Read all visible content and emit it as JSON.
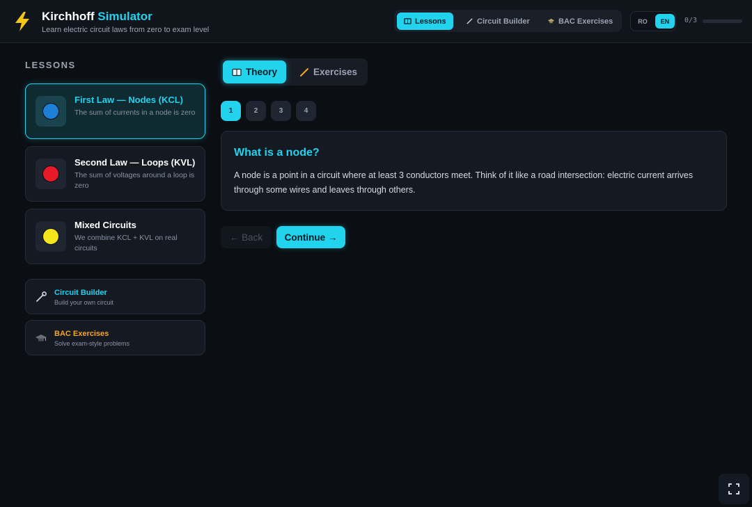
{
  "header": {
    "title_main": "Kirchhoff",
    "title_accent": "Simulator",
    "subtitle": "Learn electric circuit laws from zero to exam level",
    "nav": [
      {
        "label": "Lessons",
        "icon": "book-icon",
        "active": true
      },
      {
        "label": "Circuit Builder",
        "icon": "pencil-icon",
        "active": false
      },
      {
        "label": "BAC Exercises",
        "icon": "graduation-cap-icon",
        "active": false
      }
    ],
    "languages": [
      {
        "label": "RO",
        "active": false
      },
      {
        "label": "EN",
        "active": true
      }
    ],
    "progress_text": "0/3",
    "progress_value": 0
  },
  "sidebar": {
    "heading": "LESSONS",
    "lessons": [
      {
        "title": "First Law — Nodes (KCL)",
        "description": "The sum of currents in a node is zero",
        "dot_color": "#1e7fd6",
        "active": true
      },
      {
        "title": "Second Law — Loops (KVL)",
        "description": "The sum of voltages around a loop is zero",
        "dot_color": "#e81a2a",
        "active": false
      },
      {
        "title": "Mixed Circuits",
        "description": "We combine KCL + KVL on real circuits",
        "dot_color": "#f5e51a",
        "active": false
      }
    ],
    "tools": [
      {
        "title": "Circuit Builder",
        "description": "Build your own circuit",
        "title_color": "#22d3ee",
        "icon": "wrench-icon"
      },
      {
        "title": "BAC Exercises",
        "description": "Solve exam-style problems",
        "title_color": "#f5a524",
        "icon": "graduation-cap-icon"
      }
    ]
  },
  "main": {
    "tabs": [
      {
        "label": "Theory",
        "icon": "book-icon",
        "active": true
      },
      {
        "label": "Exercises",
        "icon": "pencil-icon",
        "active": false
      }
    ],
    "steps": [
      "1",
      "2",
      "3",
      "4"
    ],
    "active_step": 0,
    "content": {
      "title": "What is a node?",
      "body": "A node is a point in a circuit where at least 3 conductors meet. Think of it like a road intersection: electric current arrives through some wires and leaves through others."
    },
    "back_label": "← Back",
    "continue_label": "Continue →"
  },
  "colors": {
    "accent": "#22d3ee",
    "background": "#0b0e13"
  }
}
